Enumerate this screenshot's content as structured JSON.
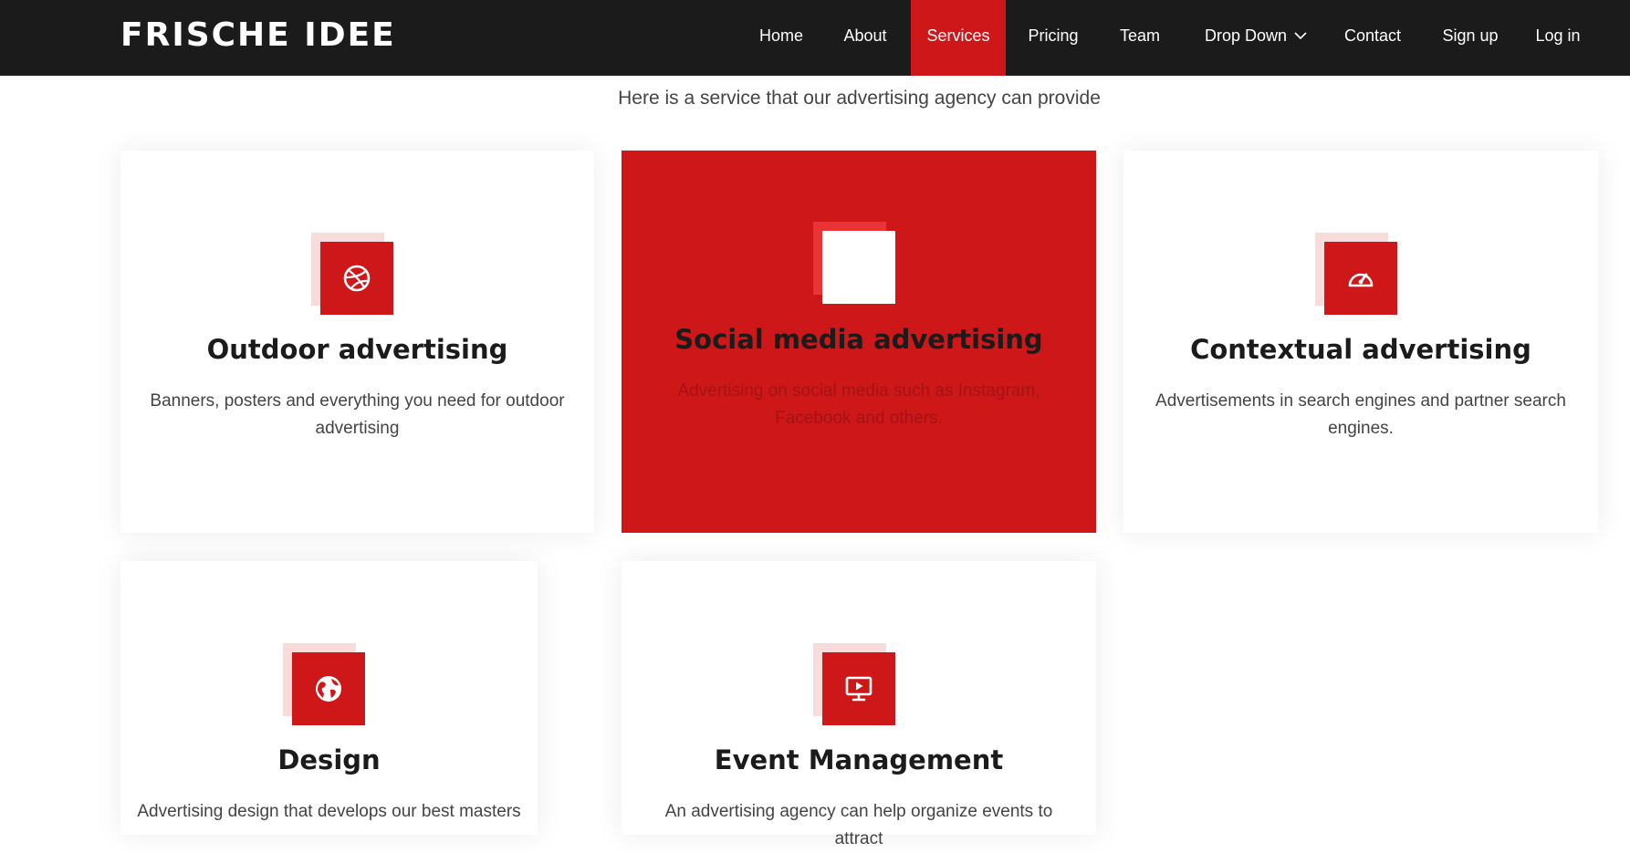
{
  "brand": {
    "name": "FRISCHE IDEE"
  },
  "nav": {
    "items": [
      {
        "label": "Home"
      },
      {
        "label": "About"
      },
      {
        "label": "Services",
        "active": true
      },
      {
        "label": "Pricing"
      },
      {
        "label": "Team"
      },
      {
        "label": "Drop Down",
        "icon": "chevron-down-icon"
      },
      {
        "label": "Contact"
      },
      {
        "label": "Sign up"
      },
      {
        "label": "Log in"
      }
    ]
  },
  "services": {
    "subtitle": "Here is a service that our advertising agency can provide",
    "cards": [
      {
        "title": "Outdoor advertising",
        "description": "Banners, posters and everything you need for outdoor advertising",
        "icon": "dribbble-icon"
      },
      {
        "title": "Social media advertising",
        "description": "Advertising on social media such as Instagram, Facebook and others.",
        "icon": "social-icon"
      },
      {
        "title": "Contextual advertising",
        "description": "Advertisements in search engines and partner search engines.",
        "icon": "speedometer-icon"
      },
      {
        "title": "Design",
        "description": "Advertising design that develops our best masters",
        "icon": "globe-icon"
      },
      {
        "title": "Event Management",
        "description": "An advertising agency can help organize events to attract",
        "icon": "presentation-icon"
      }
    ]
  },
  "colors": {
    "accent": "#cd1719",
    "navbar_bg": "#1b1b1b",
    "icon_back": "#f8dcdc",
    "text_dark": "#1b1b1b",
    "text_body": "#444444"
  }
}
